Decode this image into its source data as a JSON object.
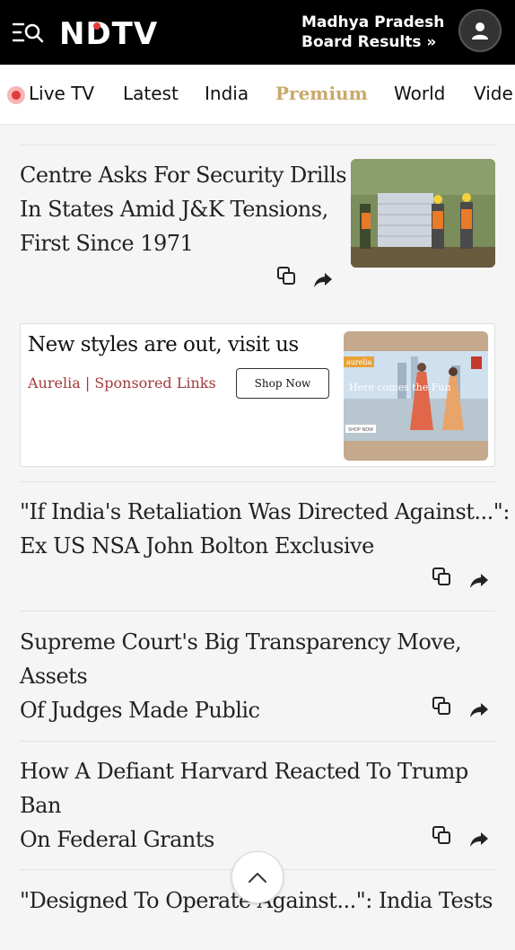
{
  "header": {
    "logo": "NDTV",
    "promo_line1": "Madhya Pradesh",
    "promo_line2": "Board Results »"
  },
  "nav": {
    "items": [
      "Live TV",
      "Latest",
      "India",
      "Premium",
      "World",
      "Vide"
    ]
  },
  "articles": [
    {
      "title_lines": [
        "Centre Asks For Security Drills",
        "In States Amid J&K Tensions,",
        "First Since 1971"
      ]
    },
    {
      "title_lines": [
        "\"If India's Retaliation Was Directed Against...\":",
        "Ex US NSA John Bolton Exclusive"
      ]
    },
    {
      "title_lines": [
        "Supreme Court's Big Transparency Move, Assets",
        "Of Judges Made Public"
      ]
    },
    {
      "title_lines": [
        "How A Defiant Harvard Reacted To Trump Ban",
        "On Federal Grants"
      ]
    },
    {
      "title_lines": [
        "\"Designed To Operate Against...\": India Tests"
      ]
    }
  ],
  "ad": {
    "title": "New styles are out, visit us",
    "sponsor": "Aurelia | Sponsored Links",
    "button": "Shop Now",
    "image_brand": "aurelia",
    "image_text": "Here comes the Fun",
    "image_cta": "SHOP NOW"
  },
  "icons": {
    "menu": "menu-icon",
    "search": "search-icon",
    "user": "user-icon",
    "copy": "copy-icon",
    "share": "share-icon",
    "up": "chevron-up-icon"
  },
  "colors": {
    "live": "#e23b3b",
    "premium": "#c9a86a",
    "sponsor": "#a33a3a"
  }
}
